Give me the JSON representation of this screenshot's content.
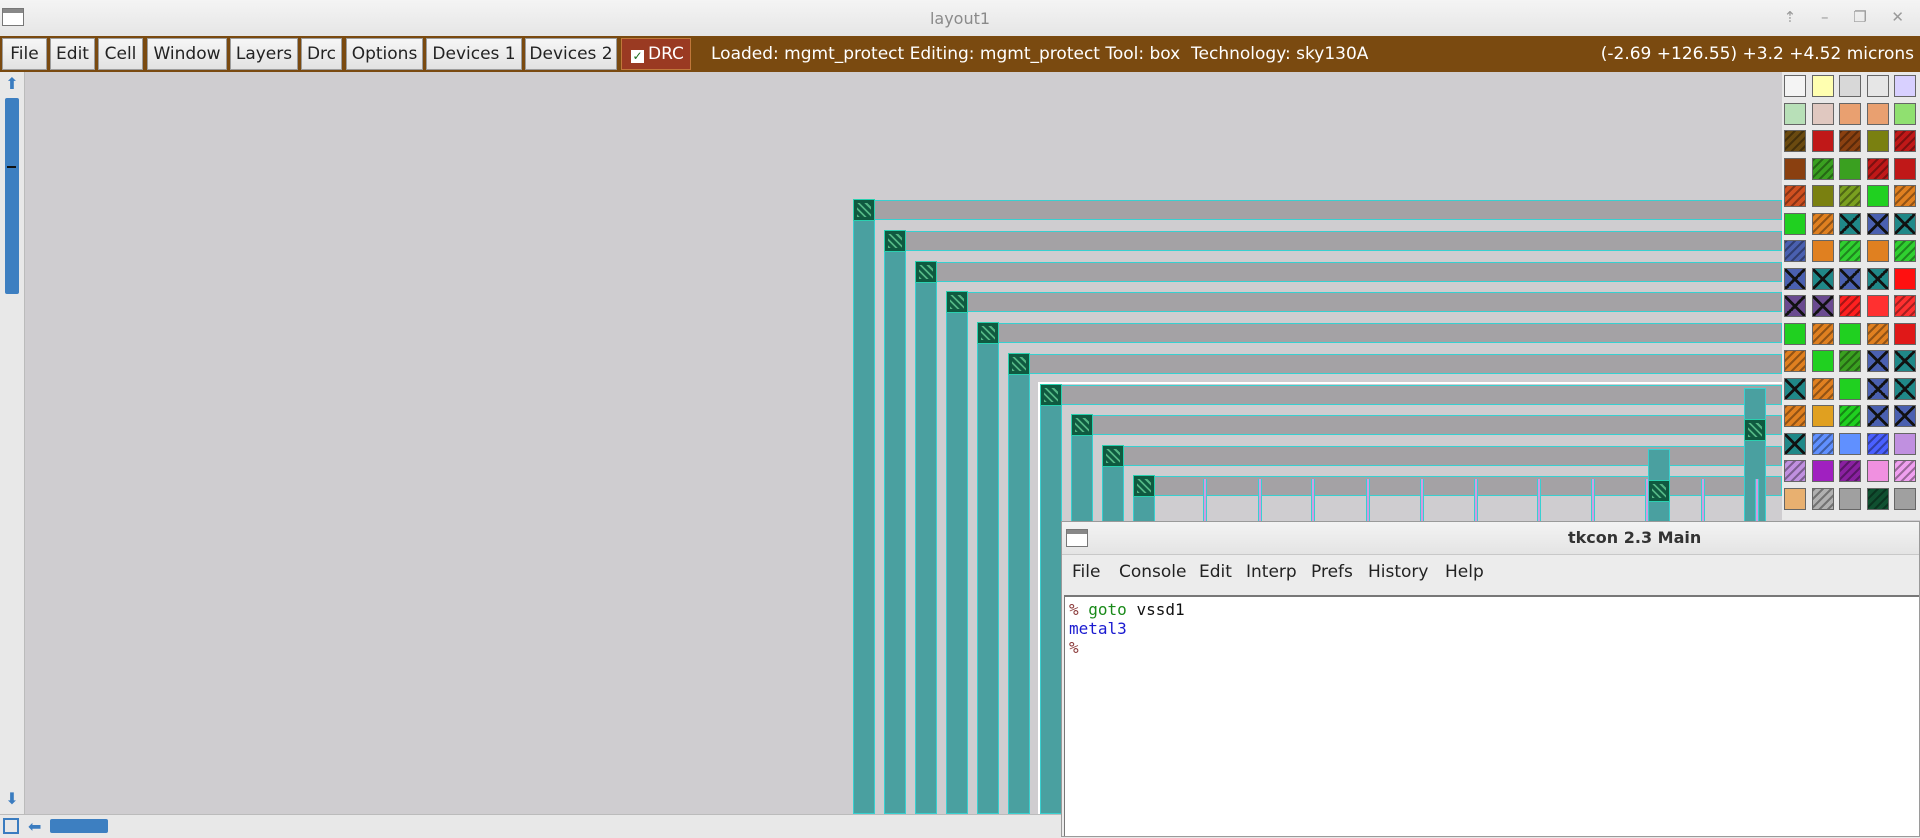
{
  "window": {
    "title": "layout1"
  },
  "menubar": {
    "items": [
      "File",
      "Edit",
      "Cell",
      "Window",
      "Layers",
      "Drc",
      "Options",
      "Devices 1",
      "Devices 2"
    ],
    "drc_toggle": {
      "label": "DRC",
      "checked": true
    },
    "status": "Loaded: mgmt_protect Editing: mgmt_protect Tool: box  Technology: sky130A",
    "coordinates": "(-2.69 +126.55) +3.2 +4.52 microns",
    "bg_color": "#7a4a10"
  },
  "tkcon": {
    "title": "tkcon 2.3 Main",
    "menu": [
      "File",
      "Console",
      "Edit",
      "Interp",
      "Prefs",
      "History",
      "Help"
    ],
    "lines": [
      {
        "prompt": "%",
        "command": "goto",
        "argument": "vssd1"
      },
      {
        "output": "metal3"
      },
      {
        "prompt": "%"
      }
    ]
  },
  "icons": {
    "window_icon": "window-icon",
    "scroll_up": "arrow-up-icon",
    "scroll_down": "arrow-down-icon",
    "scroll_left": "arrow-left-icon",
    "zoom_box": "zoom-box-icon",
    "drc_checkbox": "checkbox-icon"
  }
}
